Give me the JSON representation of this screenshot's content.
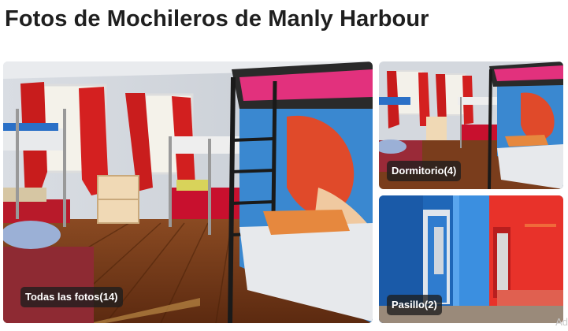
{
  "page": {
    "title": "Fotos de Mochileros de Manly Harbour"
  },
  "gallery": {
    "tiles": [
      {
        "label": "Todas las fotos(14)",
        "subject": "bunk-bed dormitory room with red curtains and mural"
      },
      {
        "label": "Dormitorio(4)",
        "subject": "dormitory room with bunk beds"
      },
      {
        "label": "Pasillo(2)",
        "subject": "blue and red painted hallway"
      }
    ]
  },
  "watermark": {
    "text": "Ad"
  },
  "colors": {
    "title": "#1f1f1f",
    "pill_bg": "rgba(30,30,30,0.78)",
    "wall_red": "#e8322a",
    "wall_blue": "#1f67b8",
    "floor_wood": "#7a3d1c"
  }
}
